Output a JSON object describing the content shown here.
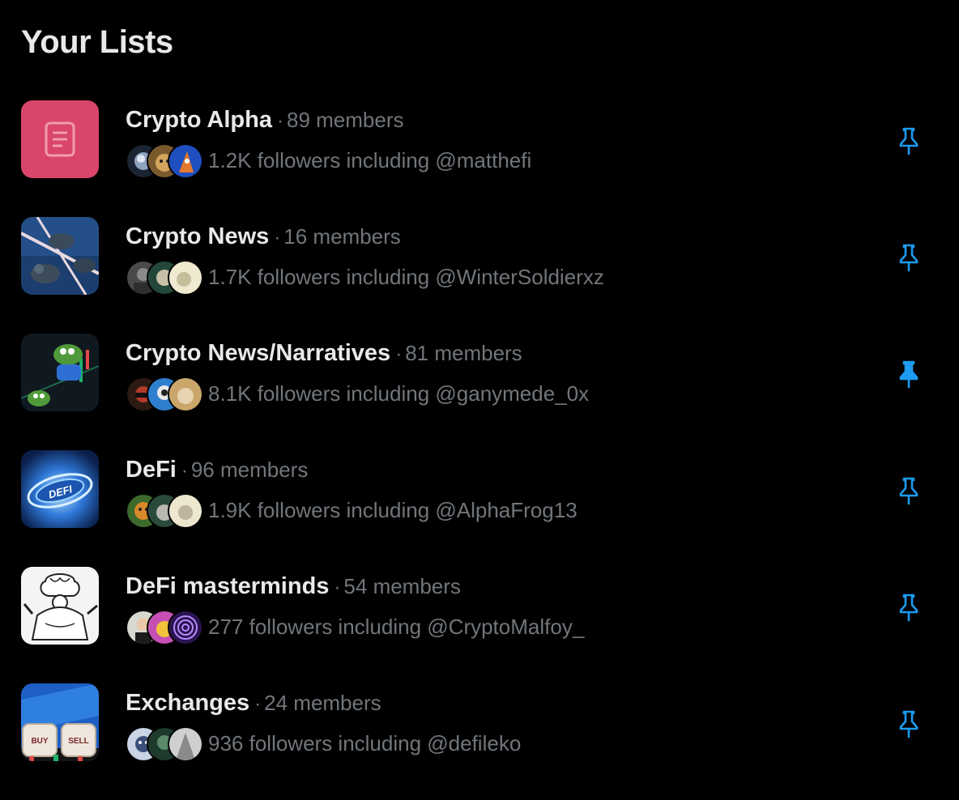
{
  "header": {
    "title": "Your Lists"
  },
  "colors": {
    "accent": "#1d9bf0",
    "muted": "#71767b",
    "text": "#e7e9ea",
    "background": "#000000"
  },
  "lists": [
    {
      "name": "Crypto Alpha",
      "separator": "·",
      "members": "89 members",
      "followers_text": "1.2K followers including @matthefi",
      "pinned": false,
      "thumb_icon": "list-document-icon"
    },
    {
      "name": "Crypto News",
      "separator": "·",
      "members": "16 members",
      "followers_text": "1.7K followers including @WinterSoldierxz",
      "pinned": false,
      "thumb_icon": "pigeons-image"
    },
    {
      "name": "Crypto News/Narratives",
      "separator": "·",
      "members": "81 members",
      "followers_text": "8.1K followers including @ganymede_0x",
      "pinned": true,
      "thumb_icon": "pepe-frog-image"
    },
    {
      "name": "DeFi",
      "separator": "·",
      "members": "96 members",
      "followers_text": "1.9K followers including @AlphaFrog13",
      "pinned": false,
      "thumb_icon": "defi-coin-image",
      "thumb_text": "DEFI"
    },
    {
      "name": "DeFi masterminds",
      "separator": "·",
      "members": "54 members",
      "followers_text": "277 followers including @CryptoMalfoy_",
      "pinned": false,
      "thumb_icon": "brain-sketch-image"
    },
    {
      "name": "Exchanges",
      "separator": "·",
      "members": "24 members",
      "followers_text": "936 followers including @defileko",
      "pinned": false,
      "thumb_icon": "buy-sell-dice-image",
      "thumb_text_1": "BUY",
      "thumb_text_2": "SELL"
    }
  ]
}
